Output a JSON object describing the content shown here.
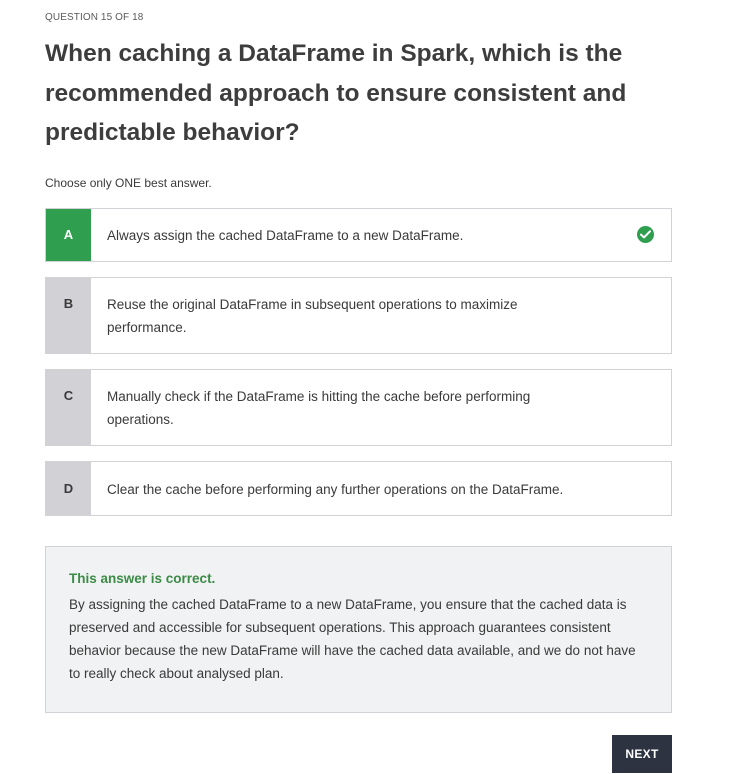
{
  "counter": "QUESTION 15 OF 18",
  "question": "When caching a DataFrame in Spark, which is the recommended approach to ensure consistent and predictable behavior?",
  "instruction": "Choose only ONE best answer.",
  "options": [
    {
      "letter": "A",
      "text": "Always assign the cached DataFrame to a new DataFrame.",
      "state": "correct"
    },
    {
      "letter": "B",
      "text": "Reuse the original DataFrame in subsequent operations to maximize performance.",
      "state": ""
    },
    {
      "letter": "C",
      "text": "Manually check if the DataFrame is hitting the cache before performing operations.",
      "state": ""
    },
    {
      "letter": "D",
      "text": "Clear the cache before performing any further operations on the DataFrame.",
      "state": ""
    }
  ],
  "explanation": {
    "result": "This answer is correct.",
    "body": "By assigning the cached DataFrame to a new DataFrame, you ensure that the cached data is preserved and accessible for subsequent operations. This approach guarantees consistent behavior because the new DataFrame will have the cached data available,  and we do not have to really check about analysed plan."
  },
  "next_label": "NEXT",
  "colors": {
    "correct": "#2f9e4f",
    "result_text": "#3b8b46",
    "letter_bg": "#d1d1d6",
    "button_bg": "#2d3340"
  },
  "icons": {
    "correct_indicator": "check-circle-icon"
  }
}
